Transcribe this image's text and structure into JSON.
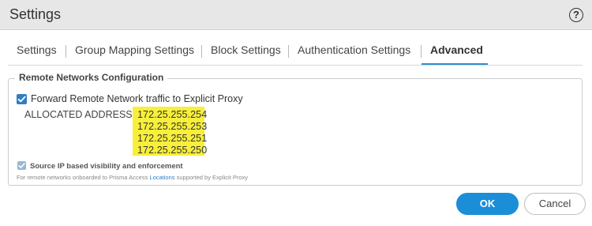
{
  "window": {
    "title": "Settings",
    "help_glyph": "?"
  },
  "tabs": [
    {
      "label": "Settings",
      "active": false
    },
    {
      "label": "Group Mapping Settings",
      "active": false
    },
    {
      "label": "Block Settings",
      "active": false
    },
    {
      "label": "Authentication Settings",
      "active": false
    },
    {
      "label": "Advanced",
      "active": true
    }
  ],
  "remote_networks": {
    "legend": "Remote Networks Configuration",
    "forward_checkbox": {
      "label": "Forward Remote Network traffic to Explicit Proxy",
      "checked": true
    },
    "allocated_label": "ALLOCATED ADDRESSES:",
    "allocated_addresses": [
      "172.25.255.254",
      "172.25.255.253",
      "172.25.255.251",
      "172.25.255.250"
    ],
    "highlight_color": "#f7ef3a",
    "source_ip_checkbox": {
      "label": "Source IP based visibility and enforcement",
      "checked": true
    },
    "note_prefix": "For remote networks onboarded to Prisma Access ",
    "note_link": "Locations",
    "note_suffix": " supported by Explicit Proxy"
  },
  "buttons": {
    "ok": "OK",
    "cancel": "Cancel"
  },
  "colors": {
    "accent": "#1a8fd8",
    "tab_underline": "#2d8fd5",
    "checkbox": "#2f7fc4",
    "titlebar": "#e7e7e7"
  }
}
